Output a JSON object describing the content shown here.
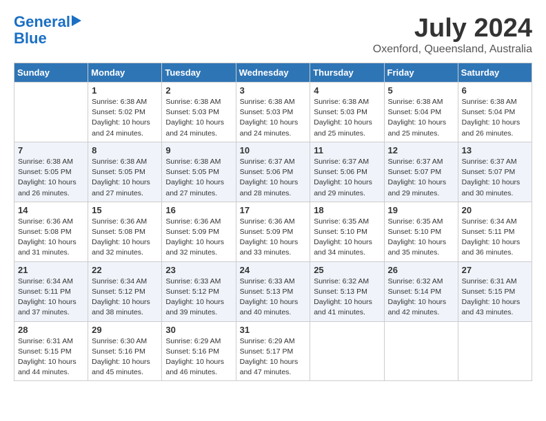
{
  "logo": {
    "line1": "General",
    "line2": "Blue",
    "arrow": true
  },
  "title": "July 2024",
  "subtitle": "Oxenford, Queensland, Australia",
  "weekdays": [
    "Sunday",
    "Monday",
    "Tuesday",
    "Wednesday",
    "Thursday",
    "Friday",
    "Saturday"
  ],
  "weeks": [
    [
      {
        "day": "",
        "info": ""
      },
      {
        "day": "1",
        "info": "Sunrise: 6:38 AM\nSunset: 5:02 PM\nDaylight: 10 hours\nand 24 minutes."
      },
      {
        "day": "2",
        "info": "Sunrise: 6:38 AM\nSunset: 5:03 PM\nDaylight: 10 hours\nand 24 minutes."
      },
      {
        "day": "3",
        "info": "Sunrise: 6:38 AM\nSunset: 5:03 PM\nDaylight: 10 hours\nand 24 minutes."
      },
      {
        "day": "4",
        "info": "Sunrise: 6:38 AM\nSunset: 5:03 PM\nDaylight: 10 hours\nand 25 minutes."
      },
      {
        "day": "5",
        "info": "Sunrise: 6:38 AM\nSunset: 5:04 PM\nDaylight: 10 hours\nand 25 minutes."
      },
      {
        "day": "6",
        "info": "Sunrise: 6:38 AM\nSunset: 5:04 PM\nDaylight: 10 hours\nand 26 minutes."
      }
    ],
    [
      {
        "day": "7",
        "info": "Sunrise: 6:38 AM\nSunset: 5:05 PM\nDaylight: 10 hours\nand 26 minutes."
      },
      {
        "day": "8",
        "info": "Sunrise: 6:38 AM\nSunset: 5:05 PM\nDaylight: 10 hours\nand 27 minutes."
      },
      {
        "day": "9",
        "info": "Sunrise: 6:38 AM\nSunset: 5:05 PM\nDaylight: 10 hours\nand 27 minutes."
      },
      {
        "day": "10",
        "info": "Sunrise: 6:37 AM\nSunset: 5:06 PM\nDaylight: 10 hours\nand 28 minutes."
      },
      {
        "day": "11",
        "info": "Sunrise: 6:37 AM\nSunset: 5:06 PM\nDaylight: 10 hours\nand 29 minutes."
      },
      {
        "day": "12",
        "info": "Sunrise: 6:37 AM\nSunset: 5:07 PM\nDaylight: 10 hours\nand 29 minutes."
      },
      {
        "day": "13",
        "info": "Sunrise: 6:37 AM\nSunset: 5:07 PM\nDaylight: 10 hours\nand 30 minutes."
      }
    ],
    [
      {
        "day": "14",
        "info": "Sunrise: 6:36 AM\nSunset: 5:08 PM\nDaylight: 10 hours\nand 31 minutes."
      },
      {
        "day": "15",
        "info": "Sunrise: 6:36 AM\nSunset: 5:08 PM\nDaylight: 10 hours\nand 32 minutes."
      },
      {
        "day": "16",
        "info": "Sunrise: 6:36 AM\nSunset: 5:09 PM\nDaylight: 10 hours\nand 32 minutes."
      },
      {
        "day": "17",
        "info": "Sunrise: 6:36 AM\nSunset: 5:09 PM\nDaylight: 10 hours\nand 33 minutes."
      },
      {
        "day": "18",
        "info": "Sunrise: 6:35 AM\nSunset: 5:10 PM\nDaylight: 10 hours\nand 34 minutes."
      },
      {
        "day": "19",
        "info": "Sunrise: 6:35 AM\nSunset: 5:10 PM\nDaylight: 10 hours\nand 35 minutes."
      },
      {
        "day": "20",
        "info": "Sunrise: 6:34 AM\nSunset: 5:11 PM\nDaylight: 10 hours\nand 36 minutes."
      }
    ],
    [
      {
        "day": "21",
        "info": "Sunrise: 6:34 AM\nSunset: 5:11 PM\nDaylight: 10 hours\nand 37 minutes."
      },
      {
        "day": "22",
        "info": "Sunrise: 6:34 AM\nSunset: 5:12 PM\nDaylight: 10 hours\nand 38 minutes."
      },
      {
        "day": "23",
        "info": "Sunrise: 6:33 AM\nSunset: 5:12 PM\nDaylight: 10 hours\nand 39 minutes."
      },
      {
        "day": "24",
        "info": "Sunrise: 6:33 AM\nSunset: 5:13 PM\nDaylight: 10 hours\nand 40 minutes."
      },
      {
        "day": "25",
        "info": "Sunrise: 6:32 AM\nSunset: 5:13 PM\nDaylight: 10 hours\nand 41 minutes."
      },
      {
        "day": "26",
        "info": "Sunrise: 6:32 AM\nSunset: 5:14 PM\nDaylight: 10 hours\nand 42 minutes."
      },
      {
        "day": "27",
        "info": "Sunrise: 6:31 AM\nSunset: 5:15 PM\nDaylight: 10 hours\nand 43 minutes."
      }
    ],
    [
      {
        "day": "28",
        "info": "Sunrise: 6:31 AM\nSunset: 5:15 PM\nDaylight: 10 hours\nand 44 minutes."
      },
      {
        "day": "29",
        "info": "Sunrise: 6:30 AM\nSunset: 5:16 PM\nDaylight: 10 hours\nand 45 minutes."
      },
      {
        "day": "30",
        "info": "Sunrise: 6:29 AM\nSunset: 5:16 PM\nDaylight: 10 hours\nand 46 minutes."
      },
      {
        "day": "31",
        "info": "Sunrise: 6:29 AM\nSunset: 5:17 PM\nDaylight: 10 hours\nand 47 minutes."
      },
      {
        "day": "",
        "info": ""
      },
      {
        "day": "",
        "info": ""
      },
      {
        "day": "",
        "info": ""
      }
    ]
  ]
}
